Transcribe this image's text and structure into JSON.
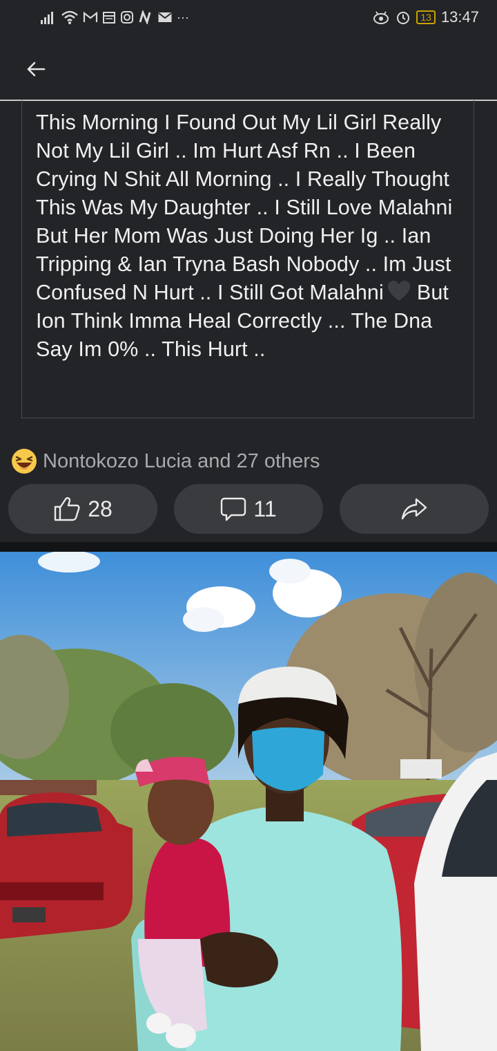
{
  "status_bar": {
    "left_icons": [
      "signal-icon",
      "wifi-icon",
      "gmail-icon",
      "calendar-icon",
      "instagram-icon",
      "news-icon",
      "mail-icon"
    ],
    "more": "···",
    "battery": "13",
    "time": "13:47"
  },
  "post": {
    "text_before_emoji": "This Morning I Found Out My Lil Girl Really Not My Lil Girl .. Im Hurt Asf Rn .. I Been Crying N Shit All Morning .. I Really Thought This Was My Daughter .. I Still Love Malahni But Her Mom Was Just Doing Her Ig .. Ian Tripping & Ian Tryna Bash Nobody .. Im Just Confused N Hurt .. I Still Got Malahni",
    "emoji": "black-heart-icon",
    "text_after_emoji": "But Ion Think Imma Heal Correctly ... The Dna Say Im 0% .. This Hurt .."
  },
  "reactions": {
    "emoji": "laughing-face-icon",
    "summary": "Nontokozo Lucia and 27 others"
  },
  "actions": {
    "like_count": "28",
    "comment_count": "11"
  },
  "colors": {
    "background": "#232427",
    "button_bg": "#3a3b3f",
    "battery": "#c8a200"
  }
}
